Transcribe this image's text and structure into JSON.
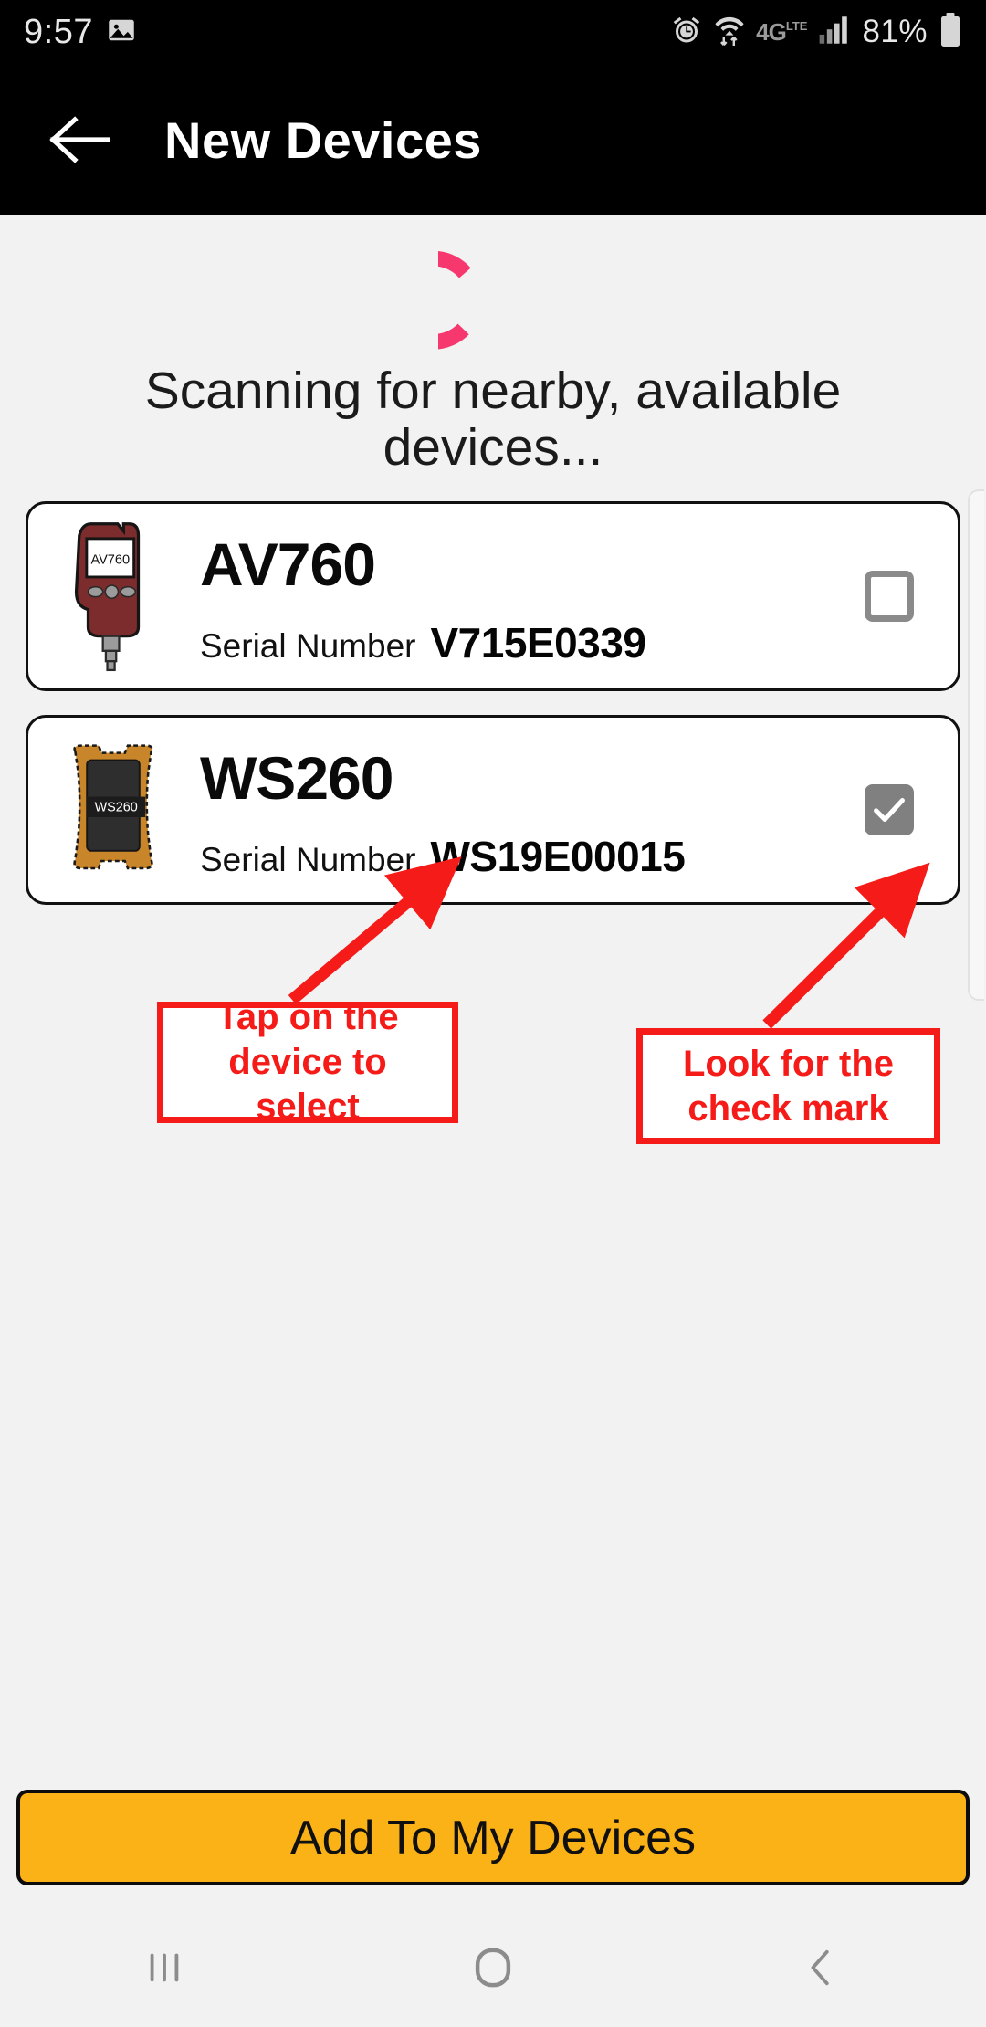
{
  "status_bar": {
    "time": "9:57",
    "battery_percent": "81%",
    "network": "4G",
    "network_sup": "LTE",
    "icons": [
      "image-icon",
      "alarm-icon",
      "wifi-icon",
      "network-4glte-icon",
      "signal-icon",
      "battery-icon"
    ]
  },
  "app_bar": {
    "title": "New Devices",
    "back_icon": "back-arrow-icon"
  },
  "scan": {
    "message": "Scanning for nearby, available devices...",
    "spinner_color": "#f6386e",
    "spinner_icon": "loading-spinner-icon"
  },
  "devices": [
    {
      "name": "AV760",
      "serial_label": "Serial Number",
      "serial_value": "V715E0339",
      "icon": "av760-gauge-icon",
      "icon_screen_text": "AV760",
      "icon_body_color": "#7c2c2c",
      "selected": false
    },
    {
      "name": "WS260",
      "serial_label": "Serial Number",
      "serial_value": "WS19E00015",
      "icon": "ws260-meter-icon",
      "icon_screen_text": "WS260",
      "icon_body_color": "#c8852a",
      "selected": true
    }
  ],
  "annotations": [
    {
      "id": "tap",
      "text": "Tap on the device to select",
      "color": "#f51b18"
    },
    {
      "id": "check",
      "text": "Look for the check mark",
      "color": "#f51b18"
    }
  ],
  "primary_button": {
    "label": "Add To My Devices",
    "color": "#fbb216"
  },
  "nav_bar": {
    "recents_icon": "recents-icon",
    "home_icon": "home-icon",
    "back_icon": "nav-back-icon"
  }
}
